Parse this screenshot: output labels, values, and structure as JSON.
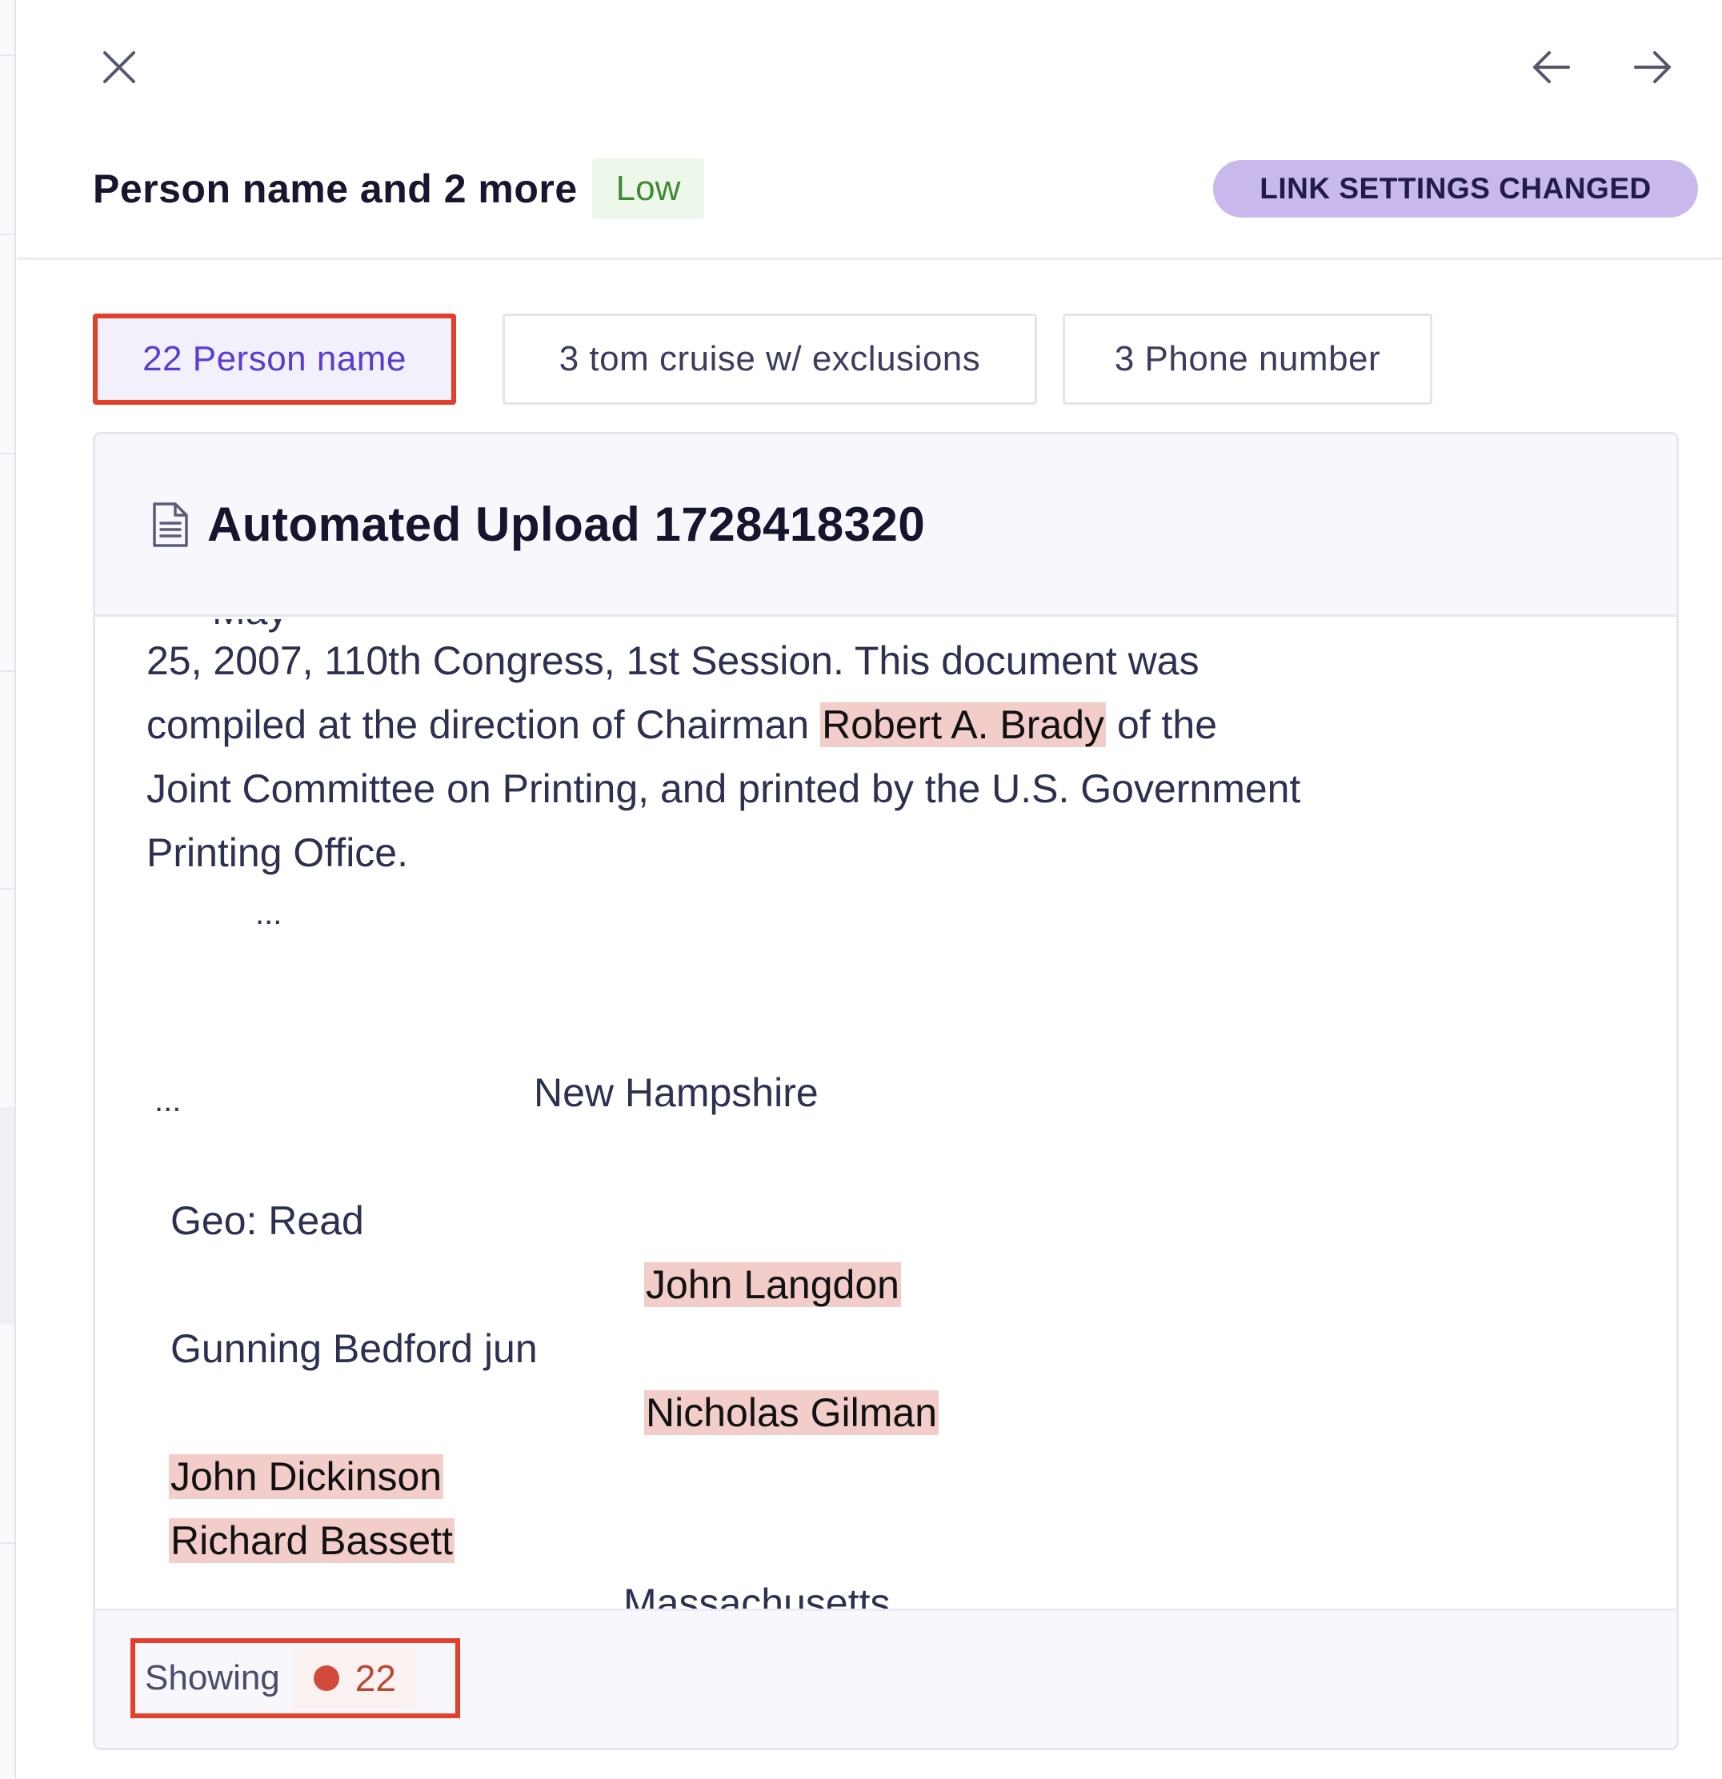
{
  "header": {
    "title": "Person name and 2 more",
    "severity": "Low",
    "status": "LINK SETTINGS CHANGED"
  },
  "tabs": [
    {
      "label": "22 Person name",
      "active": true
    },
    {
      "label": "3 tom cruise w/ exclusions",
      "active": false
    },
    {
      "label": "3 Phone number",
      "active": false
    }
  ],
  "document": {
    "title": "Automated Upload 1728418320",
    "cutoff_line": "May",
    "lines": {
      "l1": "25, 2007, 110th Congress, 1st Session. This document was",
      "l2_pre": "compiled at the direction of Chairman ",
      "l2_hl": "Robert A. Brady",
      "l2_post": " of the",
      "l3": "Joint Committee on Printing, and printed by the U.S. Government",
      "l4": "Printing Office.",
      "l5": "...",
      "l6a": "...",
      "l6b": "New Hampshire",
      "l7": "Geo: Read",
      "l8_hl": "John Langdon",
      "l9": "Gunning Bedford jun",
      "l10_hl": "Nicholas Gilman",
      "l11_hl": "John Dickinson",
      "l12_hl": "Richard Bassett",
      "l13": "Massachusetts"
    }
  },
  "footer": {
    "showing_label": "Showing",
    "count": "22"
  },
  "colors": {
    "highlight": "#f2cdca",
    "accent_border": "#e33f2a",
    "active_tab_text": "#5b3cd0",
    "status_pill": "#c9b8ec",
    "severity_low": "#3f8a37"
  },
  "icons": {
    "close": "close-icon",
    "prev": "arrow-left-icon",
    "next": "arrow-right-icon",
    "document": "document-icon"
  }
}
